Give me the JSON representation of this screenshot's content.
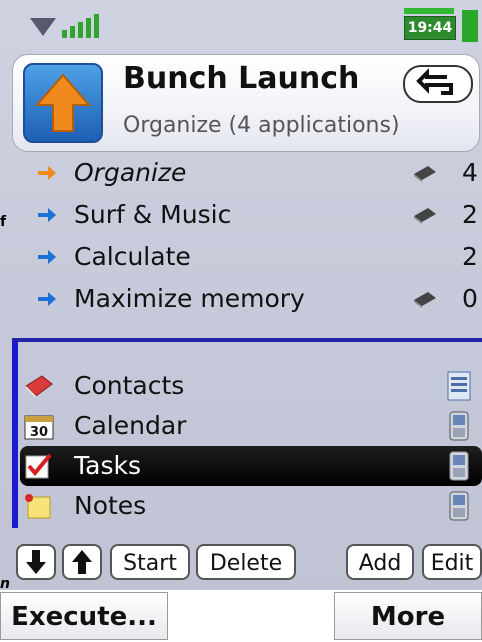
{
  "status": {
    "time": "19:44"
  },
  "header": {
    "title": "Bunch Launch",
    "subtitle": "Organize (4 applications)",
    "back_icon": "back-arrow-icon"
  },
  "groups": [
    {
      "label": "Organize",
      "count": "4",
      "has_chip": true,
      "italic": true,
      "arrow_color": "#f08a1c"
    },
    {
      "label": "Surf & Music",
      "count": "2",
      "has_chip": true,
      "italic": false,
      "arrow_color": "#1f6fd6"
    },
    {
      "label": "Calculate",
      "count": "2",
      "has_chip": false,
      "italic": false,
      "arrow_color": "#1f6fd6"
    },
    {
      "label": "Maximize memory",
      "count": "0",
      "has_chip": true,
      "italic": false,
      "arrow_color": "#1f6fd6"
    }
  ],
  "apps": [
    {
      "name": "Contacts",
      "icon": "contacts-book-icon",
      "selected": false
    },
    {
      "name": "Calendar",
      "icon": "calendar-icon",
      "icon_text": "30",
      "selected": false
    },
    {
      "name": "Tasks",
      "icon": "tasks-check-icon",
      "selected": true
    },
    {
      "name": "Notes",
      "icon": "notes-icon",
      "selected": false
    }
  ],
  "toolbar": {
    "start": "Start",
    "delete": "Delete",
    "add": "Add",
    "edit": "Edit"
  },
  "softkeys": {
    "left": "Execute...",
    "right": "More"
  },
  "side_marks": {
    "top": "f",
    "bottom": "n"
  },
  "colors": {
    "selection_bar": "#1a1ad0",
    "app_icon_orange": "#f08a1c",
    "app_icon_blue": "#1e5fb5"
  }
}
